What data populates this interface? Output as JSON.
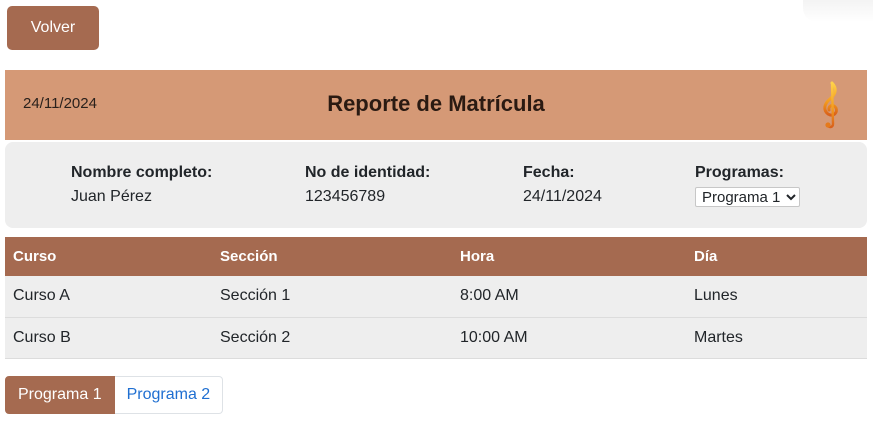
{
  "back_button": {
    "label": "Volver"
  },
  "header": {
    "date": "24/11/2024",
    "title": "Reporte de Matrícula",
    "logo_icon": "music-note-icon"
  },
  "student": {
    "name_label": "Nombre completo:",
    "name_value": "Juan Pérez",
    "id_label": "No de identidad:",
    "id_value": "123456789",
    "date_label": "Fecha:",
    "date_value": "24/11/2024",
    "programs_label": "Programas:",
    "programs_selected": "Programa 1"
  },
  "table": {
    "headers": [
      "Curso",
      "Sección",
      "Hora",
      "Día"
    ],
    "rows": [
      [
        "Curso A",
        "Sección 1",
        "8:00 AM",
        "Lunes"
      ],
      [
        "Curso B",
        "Sección 2",
        "10:00 AM",
        "Martes"
      ]
    ]
  },
  "pagination": {
    "items": [
      "Programa 1",
      "Programa 2"
    ],
    "active_index": 0
  },
  "colors": {
    "accent": "#a56a50",
    "header_bg": "#d59976",
    "card_bg": "#eeeeee",
    "link": "#1f6fd1"
  }
}
